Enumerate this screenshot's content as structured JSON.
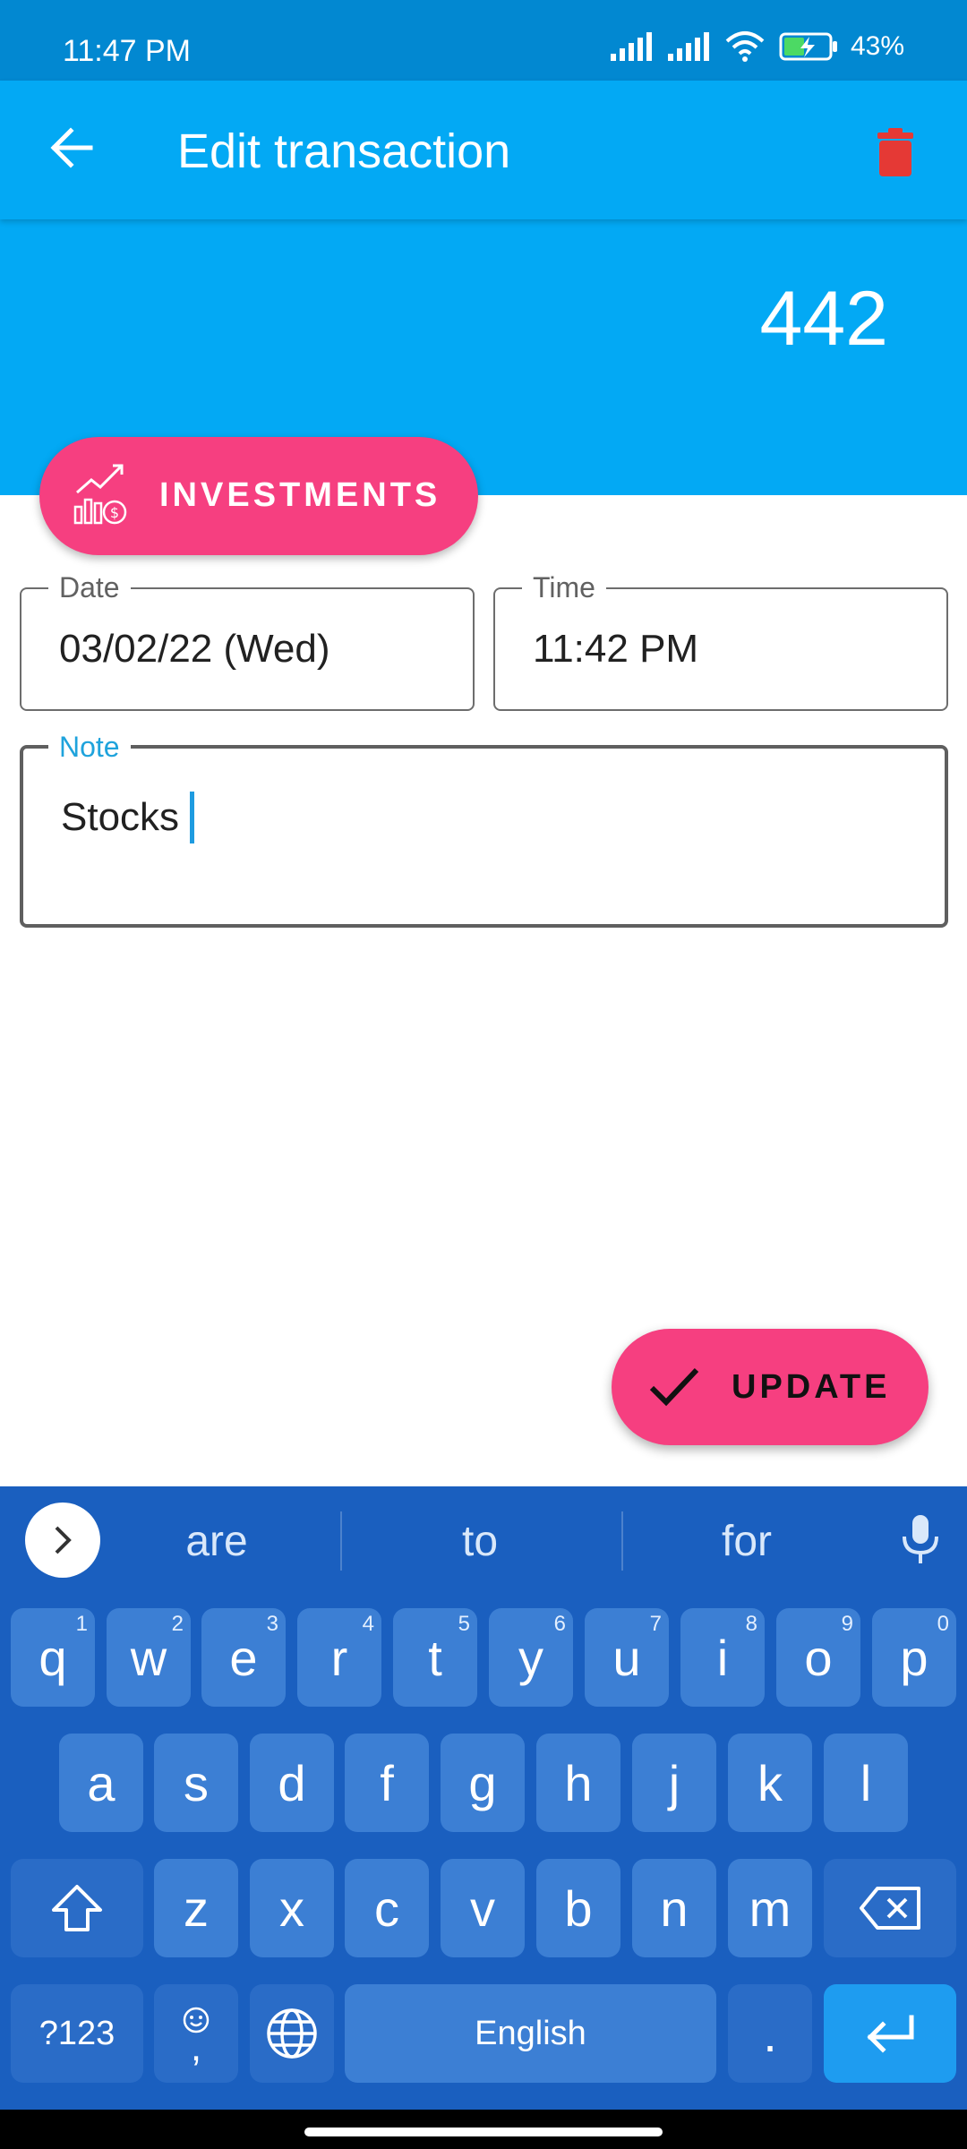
{
  "status_bar": {
    "time": "11:47 PM",
    "battery": "43%"
  },
  "app_bar": {
    "title": "Edit transaction"
  },
  "transaction": {
    "amount": "442",
    "category": "INVESTMENTS"
  },
  "fields": {
    "date_label": "Date",
    "date_value": "03/02/22 (Wed)",
    "time_label": "Time",
    "time_value": "11:42 PM",
    "note_label": "Note",
    "note_value": "Stocks"
  },
  "update_button": {
    "label": "UPDATE"
  },
  "keyboard": {
    "suggestions": [
      "are",
      "to",
      "for"
    ],
    "rows": [
      [
        {
          "key": "q",
          "hint": "1"
        },
        {
          "key": "w",
          "hint": "2"
        },
        {
          "key": "e",
          "hint": "3"
        },
        {
          "key": "r",
          "hint": "4"
        },
        {
          "key": "t",
          "hint": "5"
        },
        {
          "key": "y",
          "hint": "6"
        },
        {
          "key": "u",
          "hint": "7"
        },
        {
          "key": "i",
          "hint": "8"
        },
        {
          "key": "o",
          "hint": "9"
        },
        {
          "key": "p",
          "hint": "0"
        }
      ],
      [
        {
          "key": "a"
        },
        {
          "key": "s"
        },
        {
          "key": "d"
        },
        {
          "key": "f"
        },
        {
          "key": "g"
        },
        {
          "key": "h"
        },
        {
          "key": "j"
        },
        {
          "key": "k"
        },
        {
          "key": "l"
        }
      ],
      [
        {
          "key": "z"
        },
        {
          "key": "x"
        },
        {
          "key": "c"
        },
        {
          "key": "v"
        },
        {
          "key": "b"
        },
        {
          "key": "n"
        },
        {
          "key": "m"
        }
      ]
    ],
    "symbols_label": "?123",
    "comma_label": ",",
    "space_label": "English",
    "period_label": "."
  },
  "colors": {
    "status_bar": "#0288d1",
    "primary": "#03a9f4",
    "accent": "#f63f80",
    "delete_icon": "#e53935",
    "keyboard_bg": "#1a5fbf",
    "key_bg": "#3c7fd4",
    "enter_key": "#1e9cf0"
  },
  "icons": {
    "back": "arrow-back-icon",
    "delete": "trash-icon",
    "category": "investment-chart-icon",
    "update": "check-icon",
    "shift": "shift-icon",
    "backspace": "backspace-icon",
    "emoji": "emoji-icon",
    "language": "globe-icon",
    "enter": "enter-icon",
    "mic": "mic-icon",
    "suggest_expand": "chevron-right-icon"
  }
}
